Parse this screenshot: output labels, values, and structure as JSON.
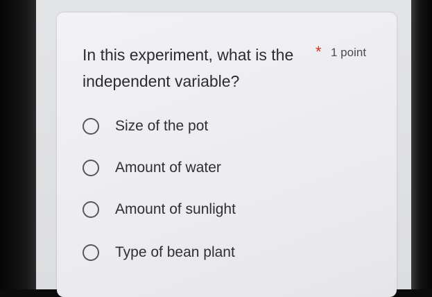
{
  "question": {
    "text": "In this experiment, what is the independent variable?",
    "required_mark": "*",
    "points": "1 point"
  },
  "options": [
    {
      "label": "Size of the pot"
    },
    {
      "label": "Amount of water"
    },
    {
      "label": "Amount of sunlight"
    },
    {
      "label": "Type of bean plant"
    }
  ],
  "colors": {
    "required": "#d93025",
    "text": "#2c2c30",
    "radio_border": "#55565a"
  }
}
